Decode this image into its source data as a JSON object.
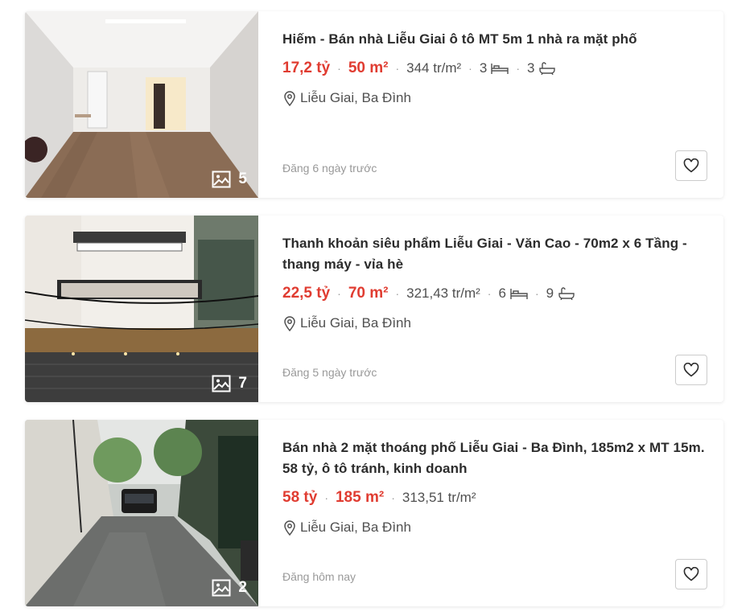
{
  "listings": [
    {
      "title": "Hiếm - Bán nhà Liễu Giai ô tô MT 5m 1 nhà ra mặt phố",
      "price": "17,2 tỷ",
      "area": "50 m²",
      "price_per_m2": "344 tr/m²",
      "bedrooms": "3",
      "bathrooms": "3",
      "location": "Liễu Giai, Ba Đình",
      "posted": "Đăng 6 ngày trước",
      "photo_count": "5"
    },
    {
      "title": "Thanh khoản siêu phẩm Liễu Giai - Văn Cao - 70m2 x 6 Tầng - thang máy - vỉa hè",
      "price": "22,5 tỷ",
      "area": "70 m²",
      "price_per_m2": "321,43 tr/m²",
      "bedrooms": "6",
      "bathrooms": "9",
      "location": "Liễu Giai, Ba Đình",
      "posted": "Đăng 5 ngày trước",
      "photo_count": "7"
    },
    {
      "title": "Bán nhà 2 mặt thoáng phố Liễu Giai - Ba Đình, 185m2 x MT 15m. 58 tỷ, ô tô tránh, kinh doanh",
      "price": "58 tỷ",
      "area": "185 m²",
      "price_per_m2": "313,51 tr/m²",
      "location": "Liễu Giai, Ba Đình",
      "posted": "Đăng hôm nay",
      "photo_count": "2"
    }
  ],
  "icons": {
    "photo": "image-icon",
    "bed": "bed-icon",
    "bath": "bathtub-icon",
    "location": "map-pin-icon",
    "favorite": "heart-icon"
  },
  "colors": {
    "price": "#e03c31",
    "text": "#2c2c2c",
    "muted": "#999999"
  }
}
